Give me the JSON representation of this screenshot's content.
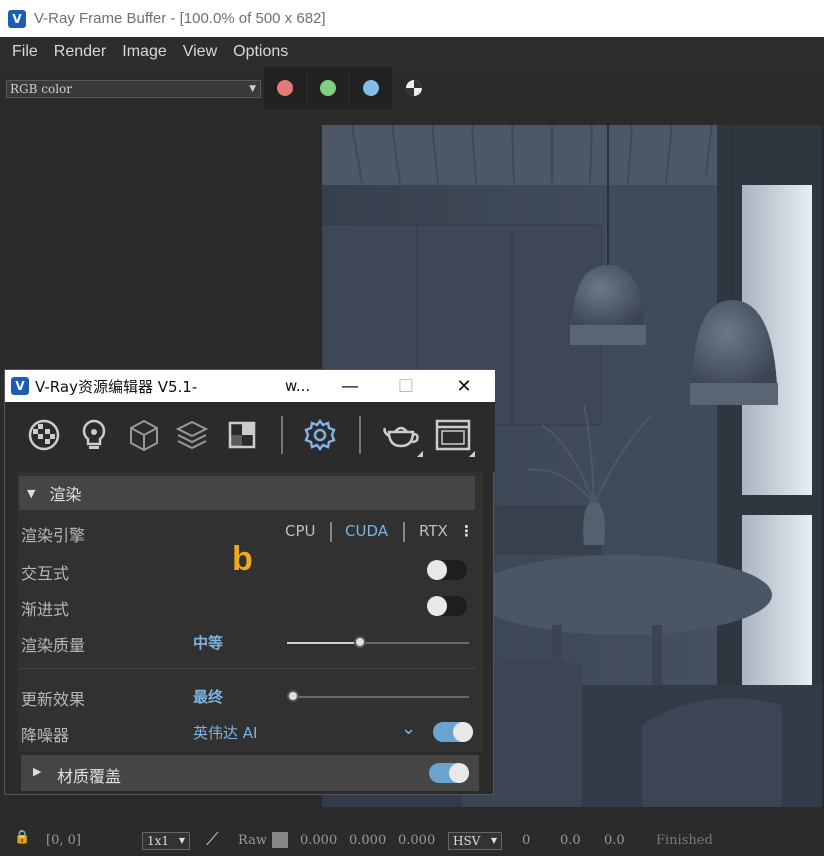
{
  "vfb": {
    "title": "V-Ray Frame Buffer - [100.0% of 500 x 682]",
    "menu": [
      "File",
      "Render",
      "Image",
      "View",
      "Options"
    ],
    "channel": "RGB color",
    "channel_dot_colors": [
      "#e87878",
      "#7fd07f",
      "#7fbfe8"
    ]
  },
  "status": {
    "coords": "[0, 0]",
    "sample_size": "1x1",
    "raw_label": "Raw",
    "rgb": [
      "0.000",
      "0.000",
      "0.000"
    ],
    "color_space": "HSV",
    "hsv": [
      "0",
      "0.0",
      "0.0"
    ],
    "state": "Finished"
  },
  "asset_editor": {
    "title": "V-Ray资源编辑器 V5.1-",
    "title_suffix": "w...",
    "toolbar_icons": [
      "materials-icon",
      "lights-icon",
      "geometry-icon",
      "layers-icon",
      "textures-icon",
      "settings-icon",
      "render-teapot-icon",
      "render-window-icon"
    ],
    "section": "渲染",
    "rows": {
      "engine_label": "渲染引擎",
      "engines": [
        "CPU",
        "CUDA",
        "RTX"
      ],
      "active_engine": "CUDA",
      "interactive_label": "交互式",
      "progressive_label": "渐进式",
      "quality_label": "渲染质量",
      "quality_value": "中等",
      "quality_level": 0.4,
      "update_label": "更新效果",
      "update_value": "最终",
      "update_level": 0.0,
      "denoiser_label": "降噪器",
      "denoiser_value": "英伟达 AI"
    },
    "toggles": {
      "interactive": false,
      "progressive": false,
      "denoiser": true,
      "material_override": true
    },
    "material_override_label": "材质覆盖"
  },
  "annotation": "b"
}
